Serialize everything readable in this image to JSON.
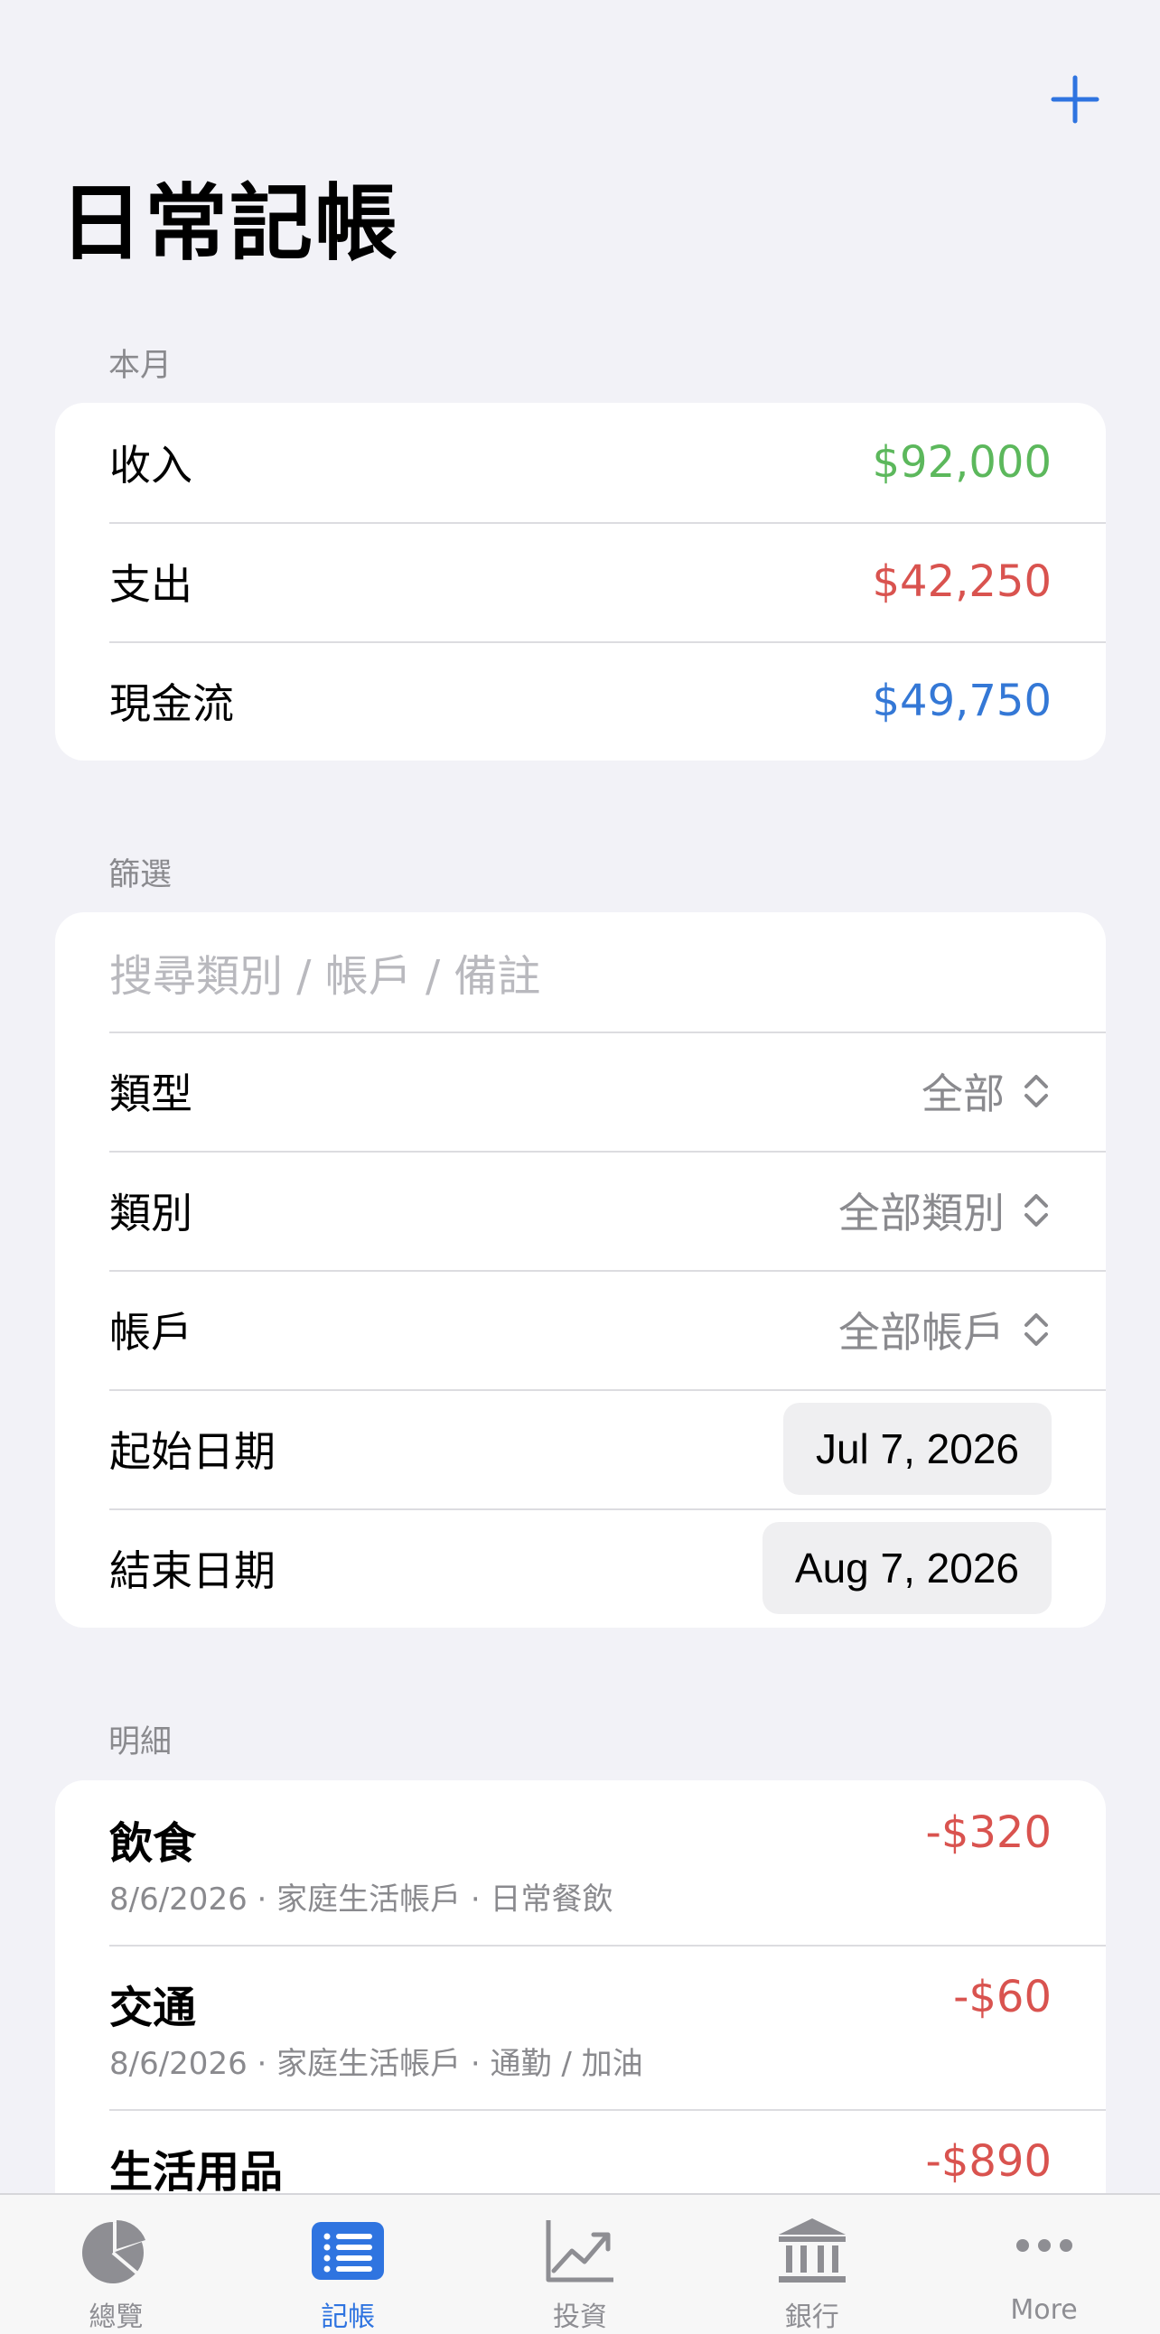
{
  "header": {
    "title": "日常記帳",
    "add_icon": "plus-icon"
  },
  "summary": {
    "header": "本月",
    "rows": [
      {
        "label": "收入",
        "value": "$92,000",
        "color": "#5cb85c"
      },
      {
        "label": "支出",
        "value": "$42,250",
        "color": "#d9534f"
      },
      {
        "label": "現金流",
        "value": "$49,750",
        "color": "#3478d6"
      }
    ]
  },
  "filter": {
    "header": "篩選",
    "search_placeholder": "搜尋類別 / 帳戶 / 備註",
    "type_label": "類型",
    "type_value": "全部",
    "category_label": "類別",
    "category_value": "全部類別",
    "account_label": "帳戶",
    "account_value": "全部帳戶",
    "start_label": "起始日期",
    "start_value": "Jul 7, 2026",
    "end_label": "結束日期",
    "end_value": "Aug 7, 2026"
  },
  "details": {
    "header": "明細",
    "items": [
      {
        "title": "飲食",
        "subtitle": "8/6/2026 · 家庭生活帳戶 · 日常餐飲",
        "amount": "-$320"
      },
      {
        "title": "交通",
        "subtitle": "8/6/2026 · 家庭生活帳戶 · 通勤 / 加油",
        "amount": "-$60"
      },
      {
        "title": "生活用品",
        "subtitle": "",
        "amount": "-$890"
      }
    ]
  },
  "tabbar": {
    "accent": "#2f74e0",
    "tabs": [
      {
        "label": "總覽",
        "icon": "pie-chart-icon",
        "active": false
      },
      {
        "label": "記帳",
        "icon": "list-icon",
        "active": true
      },
      {
        "label": "投資",
        "icon": "line-chart-icon",
        "active": false
      },
      {
        "label": "銀行",
        "icon": "bank-icon",
        "active": false
      },
      {
        "label": "More",
        "icon": "more-icon",
        "active": false
      }
    ]
  }
}
